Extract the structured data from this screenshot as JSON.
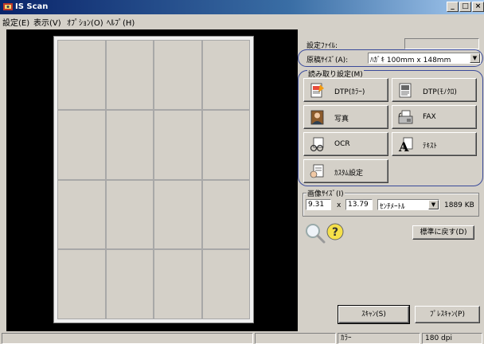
{
  "window": {
    "title": "IS Scan",
    "controls": {
      "minimize": "_",
      "maximize": "□",
      "close": "×"
    }
  },
  "menu": [
    {
      "label": "設定(E)"
    },
    {
      "label": "表示(V)"
    },
    {
      "label": "ｵﾌﾟｼｮﾝ(O)"
    },
    {
      "label": "ﾍﾙﾌﾟ(H)"
    }
  ],
  "settings": {
    "file_label": "設定ﾌｧｲﾙ:",
    "file_value": "",
    "doc_size_label": "原稿ｻｲｽﾞ(A):",
    "doc_size_value": "ﾊｶﾞｷ 100mm x 148mm",
    "read_settings_label": "読み取り設定(M)"
  },
  "modes": [
    {
      "label": "DTP(ｶﾗｰ)",
      "icon": "dtp-color-icon"
    },
    {
      "label": "DTP(ﾓﾉｸﾛ)",
      "icon": "dtp-mono-icon"
    },
    {
      "label": "写真",
      "icon": "photo-icon"
    },
    {
      "label": "FAX",
      "icon": "fax-icon"
    },
    {
      "label": "OCR",
      "icon": "ocr-icon"
    },
    {
      "label": "ﾃｷｽﾄ",
      "icon": "text-icon"
    },
    {
      "label": "ｶｽﾀﾑ設定",
      "icon": "custom-settings-icon"
    }
  ],
  "image_size": {
    "label": "画像ｻｲｽﾞ(I)",
    "width": "9.31",
    "times": "x",
    "height": "13.79",
    "unit": "ｾﾝﾁﾒｰﾄﾙ",
    "filesize": "1889 KB"
  },
  "buttons": {
    "reset": "標準に戻す(D)",
    "scan": "ｽｷｬﾝ(S)",
    "prescan": "ﾌﾟﾚｽｷｬﾝ(P)"
  },
  "status": {
    "left": "",
    "mid": "",
    "color_mode": "ｶﾗｰ",
    "resolution": "180 dpi"
  },
  "colors": {
    "titlebar": "#0a246a",
    "face": "#d4d0c8",
    "oval_highlight": "#3a4a9a",
    "preview_bg": "#000000"
  }
}
